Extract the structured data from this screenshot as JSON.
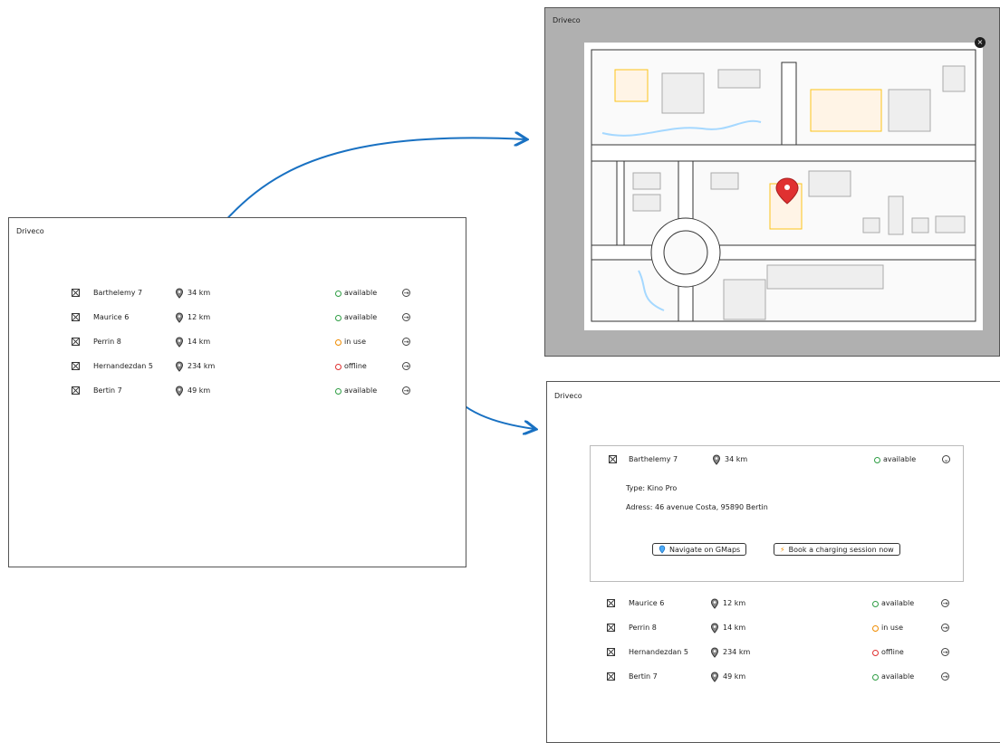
{
  "colors": {
    "available": "#2f9e44",
    "in_use": "#f08c00",
    "offline": "#e03131",
    "arrow": "#1971c2",
    "pin": "#e03131"
  },
  "left": {
    "title": "Driveco",
    "rows": [
      {
        "name": "Barthelemy 7",
        "distance": "34 km",
        "status": "available"
      },
      {
        "name": "Maurice 6",
        "distance": "12 km",
        "status": "available"
      },
      {
        "name": "Perrin 8",
        "distance": "14 km",
        "status": "in use"
      },
      {
        "name": "Hernandezdan 5",
        "distance": "234 km",
        "status": "offline"
      },
      {
        "name": "Bertin 7",
        "distance": "49 km",
        "status": "available"
      }
    ]
  },
  "map": {
    "title": "Driveco",
    "close_icon": "close-icon"
  },
  "detail": {
    "title": "Driveco",
    "expanded": {
      "name": "Barthelemy 7",
      "distance": "34 km",
      "status": "available",
      "type": "Type: Kino Pro",
      "address": "Adress: 46 avenue Costa, 95890 Bertin",
      "navigate_label": "Navigate on GMaps",
      "book_label": "Book a charging session now"
    },
    "rows": [
      {
        "name": "Maurice 6",
        "distance": "12 km",
        "status": "available"
      },
      {
        "name": "Perrin 8",
        "distance": "14 km",
        "status": "in use"
      },
      {
        "name": "Hernandezdan 5",
        "distance": "234 km",
        "status": "offline"
      },
      {
        "name": "Bertin 7",
        "distance": "49 km",
        "status": "available"
      }
    ]
  }
}
